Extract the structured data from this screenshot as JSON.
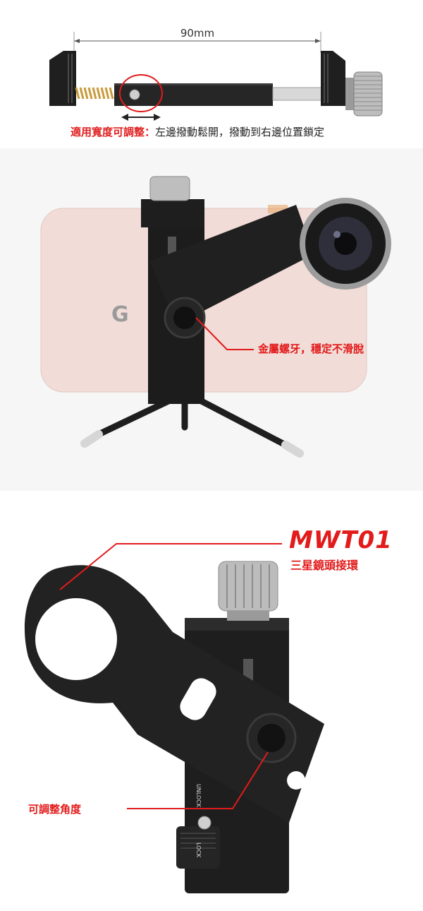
{
  "panel1": {
    "dimension": "90mm",
    "caption_label": "適用寬度可調整：",
    "caption_text": "左邊撥動鬆開，撥動到右邊位置鎖定"
  },
  "panel2": {
    "phone_logo": "G",
    "callout": "金屬螺牙，穩定不滑脫"
  },
  "panel3": {
    "model": "MWT01",
    "model_desc": "三星鏡頭接環",
    "angle_callout": "可調整角度",
    "unlock_label": "UNLOCK",
    "lock_label": "LOCK"
  },
  "colors": {
    "accent_red": "#e21b1b",
    "metal_black": "#1e1e1e",
    "phone_pink": "#f1dcd7"
  }
}
